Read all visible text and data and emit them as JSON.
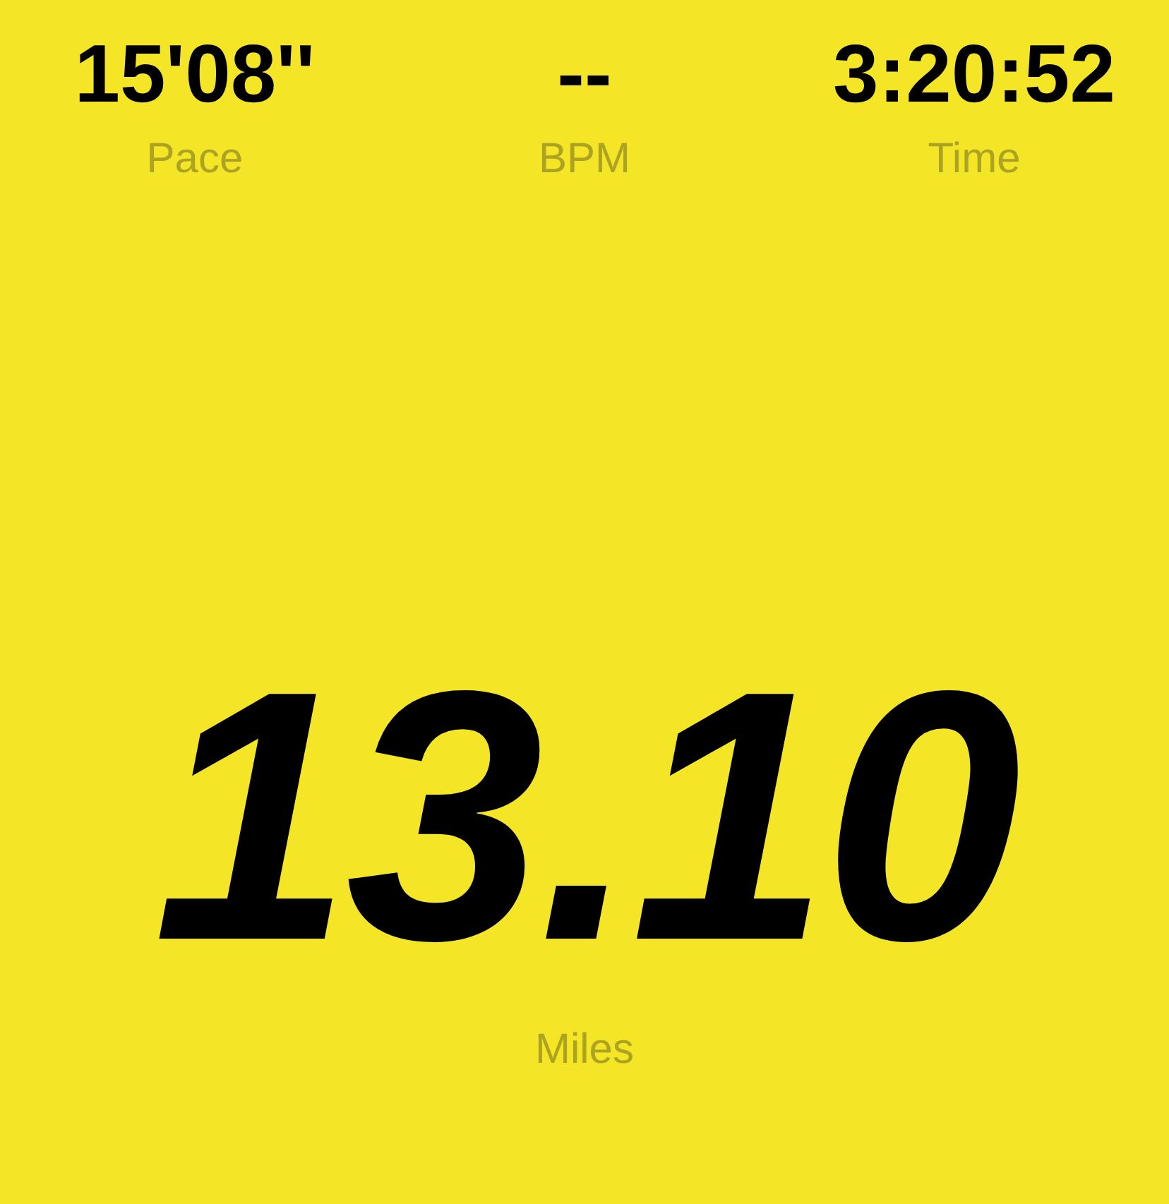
{
  "stats": [
    {
      "value": "15'08''",
      "label": "Pace"
    },
    {
      "value": "--",
      "label": "BPM"
    },
    {
      "value": "3:20:52",
      "label": "Time"
    }
  ],
  "distance": {
    "value": "13.10",
    "label": "Miles"
  }
}
